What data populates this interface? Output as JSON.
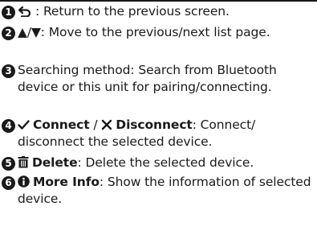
{
  "items": [
    {
      "number": "1",
      "icon_name": "back-arrow-icon",
      "text": ": Return to the previous screen."
    },
    {
      "number": "2",
      "icon_symbol": "▲/▼",
      "text": ": Move to the previous/next list page."
    },
    {
      "number": "3",
      "text": "Searching method: Search from Bluetooth device or this unit for pairing/connecting."
    },
    {
      "number": "4",
      "connect_icon": "check-icon",
      "connect_label": "Connect",
      "separator": " / ",
      "disconnect_icon": "cross-icon",
      "disconnect_label": "Disconnect",
      "text": ": Connect/ disconnect the selected device."
    },
    {
      "number": "5",
      "icon_name": "trash-icon",
      "label": "Delete",
      "text": ": Delete the selected device."
    },
    {
      "number": "6",
      "icon_name": "info-icon",
      "label": "More Info",
      "text": ": Show the information of selected device."
    }
  ]
}
